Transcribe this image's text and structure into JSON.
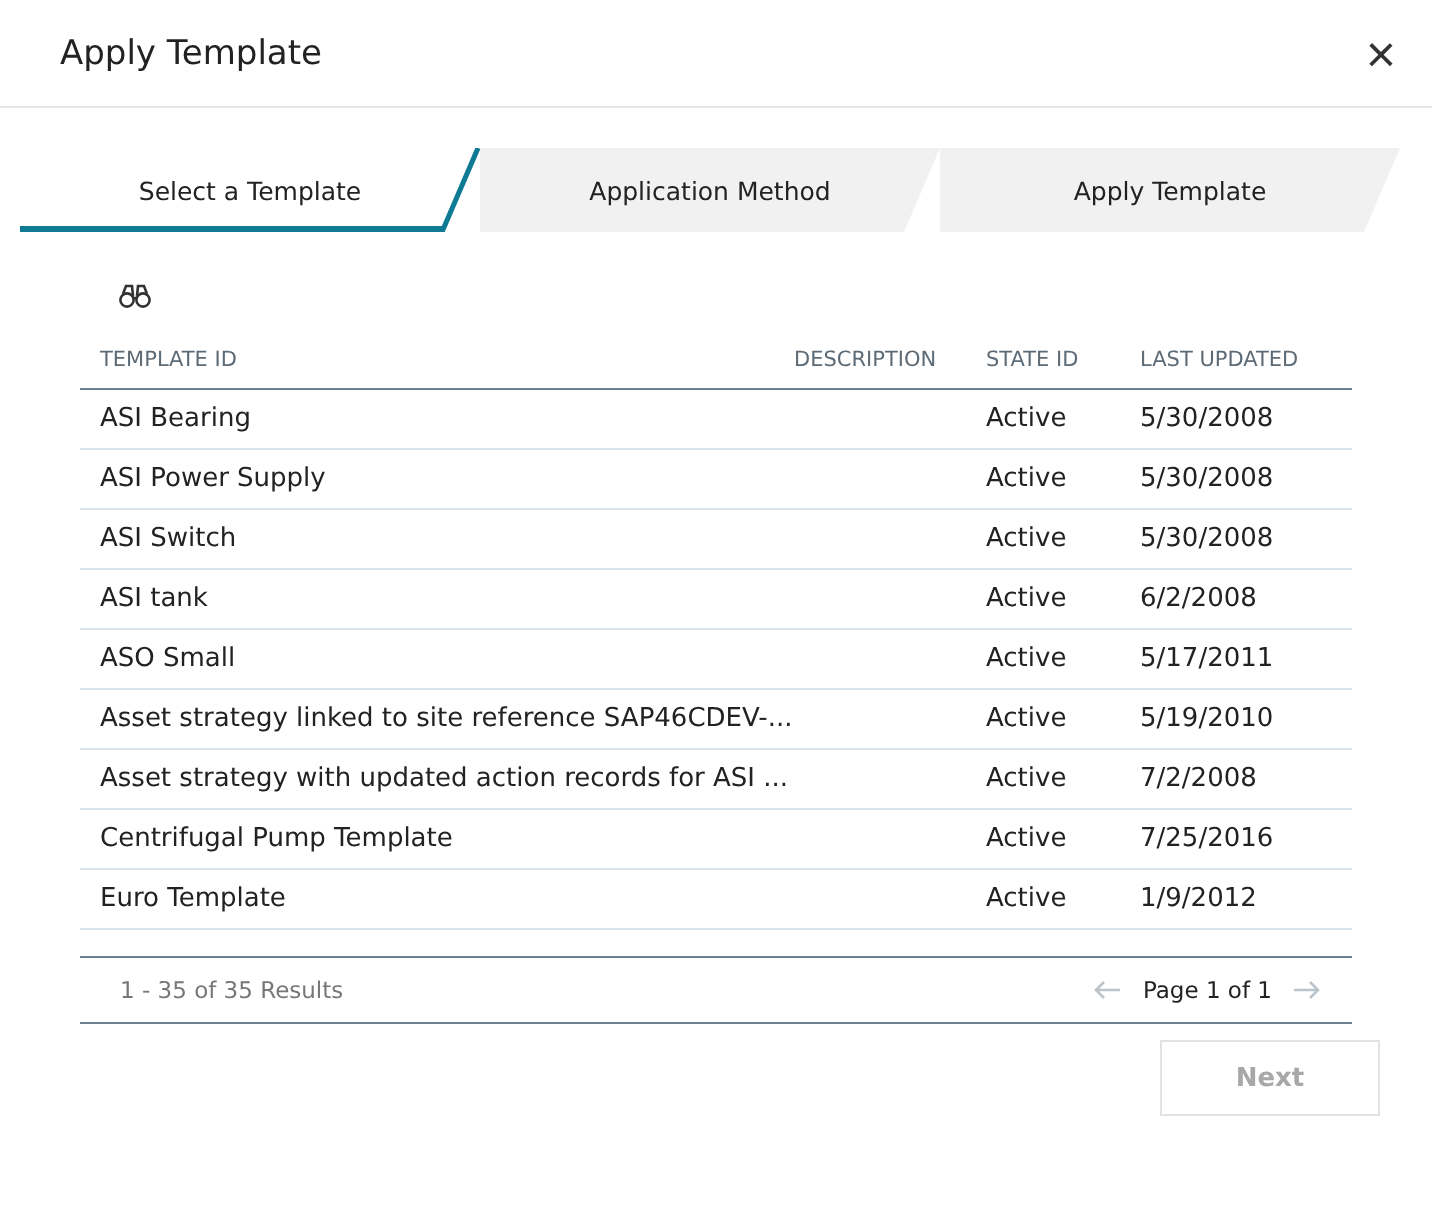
{
  "dialog": {
    "title": "Apply Template",
    "close": "×"
  },
  "steps": [
    {
      "label": "Select a Template",
      "selected": true
    },
    {
      "label": "Application Method",
      "selected": false
    },
    {
      "label": "Apply Template",
      "selected": false
    }
  ],
  "table": {
    "columns": [
      "TEMPLATE ID",
      "DESCRIPTION",
      "STATE ID",
      "LAST UPDATED"
    ],
    "rows": [
      [
        "ASI Bearing",
        "",
        "Active",
        "5/30/2008"
      ],
      [
        "ASI Power Supply",
        "",
        "Active",
        "5/30/2008"
      ],
      [
        "ASI Switch",
        "",
        "Active",
        "5/30/2008"
      ],
      [
        "ASI tank",
        "",
        "Active",
        "6/2/2008"
      ],
      [
        "ASO Small",
        "",
        "Active",
        "5/17/2011"
      ],
      [
        "Asset strategy linked to site reference SAP46CDEV-...",
        "",
        "Active",
        "5/19/2010"
      ],
      [
        "Asset strategy with updated action records for ASI ...",
        "",
        "Active",
        "7/2/2008"
      ],
      [
        "Centrifugal Pump Template",
        "",
        "Active",
        "7/25/2016"
      ],
      [
        "Euro Template",
        "",
        "Active",
        "1/9/2012"
      ]
    ]
  },
  "footer": {
    "results": "1 - 35 of 35 Results",
    "page": "Page 1 of 1"
  },
  "next_button": {
    "label": "Next",
    "disabled": true
  }
}
